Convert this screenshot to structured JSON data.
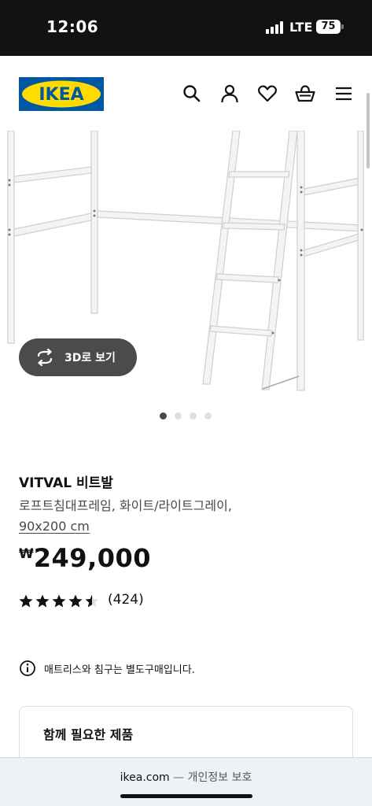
{
  "status_bar": {
    "time": "12:06",
    "network": "LTE",
    "battery": "75"
  },
  "header": {
    "logo_text": "IKEA",
    "icons": [
      "search-icon",
      "account-icon",
      "heart-icon",
      "basket-icon",
      "menu-icon"
    ],
    "brand_blue": "#0058A3",
    "brand_yellow": "#FFDB00"
  },
  "gallery": {
    "view_3d_label": "3D로 보기",
    "slide_count": 4,
    "active_slide": 1
  },
  "product": {
    "name": "VITVAL 비트발",
    "description": "로프트침대프레임, 화이트/라이트그레이,",
    "size": "90x200 cm",
    "currency": "₩",
    "price": "249,000",
    "rating": 4.5,
    "rating_max": 5,
    "review_count": "(424)"
  },
  "notice": {
    "text": "매트리스와 침구는 별도구매입니다."
  },
  "related": {
    "title": "함께 필요한 제품"
  },
  "browser": {
    "domain": "ikea.com",
    "separator": "—",
    "privacy": "개인정보 보호"
  }
}
